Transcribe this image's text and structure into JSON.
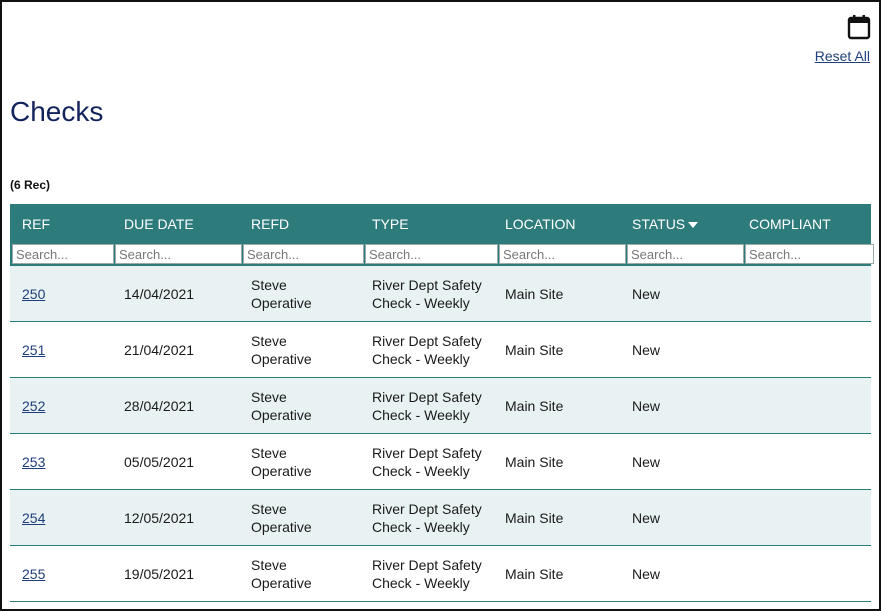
{
  "header": {
    "calendar_icon": "calendar-icon",
    "reset_all_label": "Reset All"
  },
  "page": {
    "title": "Checks",
    "record_count": "(6 Rec)"
  },
  "table": {
    "columns": [
      "REF",
      "DUE DATE",
      "REFD",
      "TYPE",
      "LOCATION",
      "STATUS",
      "COMPLIANT"
    ],
    "sorted_column": "STATUS",
    "sort_direction": "descending",
    "search_placeholder": "Search...",
    "row_stripe_color": "#e8f2f2",
    "header_color": "#2d7b7b",
    "rows": [
      {
        "ref": "250",
        "due_date": "14/04/2021",
        "refd_line1": "Steve",
        "refd_line2": "Operative",
        "type_line1": "River Dept Safety",
        "type_line2": "Check - Weekly",
        "location": "Main Site",
        "status": "New",
        "compliant": ""
      },
      {
        "ref": "251",
        "due_date": "21/04/2021",
        "refd_line1": "Steve",
        "refd_line2": "Operative",
        "type_line1": "River Dept Safety",
        "type_line2": "Check - Weekly",
        "location": "Main Site",
        "status": "New",
        "compliant": ""
      },
      {
        "ref": "252",
        "due_date": "28/04/2021",
        "refd_line1": "Steve",
        "refd_line2": "Operative",
        "type_line1": "River Dept Safety",
        "type_line2": "Check - Weekly",
        "location": "Main Site",
        "status": "New",
        "compliant": ""
      },
      {
        "ref": "253",
        "due_date": "05/05/2021",
        "refd_line1": "Steve",
        "refd_line2": "Operative",
        "type_line1": "River Dept Safety",
        "type_line2": "Check - Weekly",
        "location": "Main Site",
        "status": "New",
        "compliant": ""
      },
      {
        "ref": "254",
        "due_date": "12/05/2021",
        "refd_line1": "Steve",
        "refd_line2": "Operative",
        "type_line1": "River Dept Safety",
        "type_line2": "Check - Weekly",
        "location": "Main Site",
        "status": "New",
        "compliant": ""
      },
      {
        "ref": "255",
        "due_date": "19/05/2021",
        "refd_line1": "Steve",
        "refd_line2": "Operative",
        "type_line1": "River Dept Safety",
        "type_line2": "Check - Weekly",
        "location": "Main Site",
        "status": "New",
        "compliant": ""
      }
    ]
  }
}
